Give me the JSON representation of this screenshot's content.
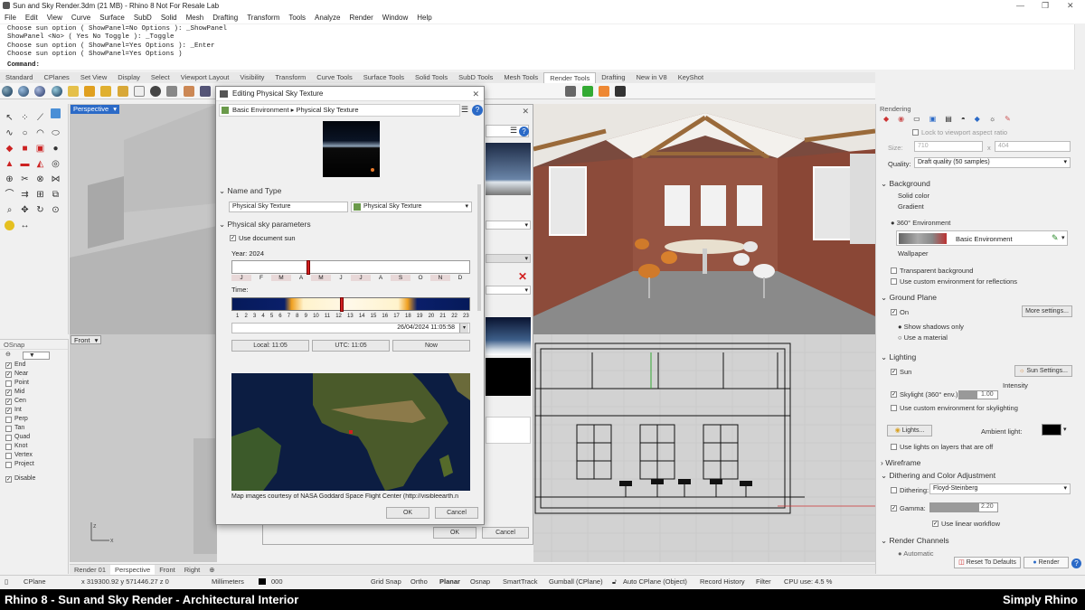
{
  "window": {
    "title": "Sun and Sky Render.3dm (21 MB) - Rhino 8 Not For Resale Lab"
  },
  "menu": [
    "File",
    "Edit",
    "View",
    "Curve",
    "Surface",
    "SubD",
    "Solid",
    "Mesh",
    "Drafting",
    "Transform",
    "Tools",
    "Analyze",
    "Render",
    "Window",
    "Help"
  ],
  "command": {
    "history": [
      "Choose sun option ( ShowPanel=No  Options ): _ShowPanel",
      "ShowPanel <No> ( Yes  No  Toggle ): _Toggle",
      "Choose sun option ( ShowPanel=Yes  Options ): _Enter",
      "Choose sun option ( ShowPanel=Yes  Options )"
    ],
    "prompt": "Command:"
  },
  "toolbar_tabs": [
    "Standard",
    "CPlanes",
    "Set View",
    "Display",
    "Select",
    "Viewport Layout",
    "Visibility",
    "Transform",
    "Curve Tools",
    "Surface Tools",
    "Solid Tools",
    "SubD Tools",
    "Mesh Tools",
    "Render Tools",
    "Drafting",
    "New in V8",
    "KeyShot"
  ],
  "toolbar_tabs_selected": "Render Tools",
  "viewports": {
    "perspective": "Perspective",
    "front": "Front"
  },
  "osnap": {
    "title": "OSnap",
    "items": [
      {
        "label": "End",
        "checked": true
      },
      {
        "label": "Near",
        "checked": true
      },
      {
        "label": "Point",
        "checked": false
      },
      {
        "label": "Mid",
        "checked": true
      },
      {
        "label": "Cen",
        "checked": true
      },
      {
        "label": "Int",
        "checked": true
      },
      {
        "label": "Perp",
        "checked": false
      },
      {
        "label": "Tan",
        "checked": false
      },
      {
        "label": "Quad",
        "checked": false
      },
      {
        "label": "Knot",
        "checked": false
      },
      {
        "label": "Vertex",
        "checked": false
      },
      {
        "label": "Project",
        "checked": false
      }
    ],
    "disable": "Disable"
  },
  "dialog": {
    "title": "Editing Physical Sky Texture",
    "breadcrumb_root": "Basic Environment",
    "breadcrumb_sep": "▸",
    "breadcrumb_leaf": "Physical Sky Texture",
    "name_type_section": "Name and Type",
    "name_value": "Physical Sky Texture",
    "type_value": "Physical Sky Texture",
    "params_section": "Physical sky parameters",
    "use_doc_sun": "Use document sun",
    "year_label": "Year: 2024",
    "months": [
      "J",
      "F",
      "M",
      "A",
      "M",
      "J",
      "J",
      "A",
      "S",
      "O",
      "N",
      "D"
    ],
    "time_label": "Time:",
    "hours": [
      "1",
      "2",
      "3",
      "4",
      "5",
      "6",
      "7",
      "8",
      "9",
      "10",
      "11",
      "12",
      "13",
      "14",
      "15",
      "16",
      "17",
      "18",
      "19",
      "20",
      "21",
      "22",
      "23"
    ],
    "datetime": "26/04/2024 11:05:58",
    "local": "Local: 11:05",
    "utc": "UTC: 11:05",
    "now": "Now",
    "map_credit": "Map images courtesy of NASA Goddard Space Flight Center (http://visibleearth.n",
    "ok": "OK",
    "cancel": "Cancel"
  },
  "bg_dialog": {
    "ok": "OK",
    "cancel": "Cancel"
  },
  "rendering": {
    "title": "Rendering",
    "lock_aspect": "Lock to viewport aspect ratio",
    "size_label": "Size:",
    "width": "710",
    "x": "x",
    "height": "404",
    "quality_label": "Quality:",
    "quality_value": "Draft quality (50 samples)",
    "background": "Background",
    "solid_color": "Solid color",
    "gradient": "Gradient",
    "env360": "360° Environment",
    "env_name": "Basic Environment",
    "wallpaper": "Wallpaper",
    "transparent_bg": "Transparent background",
    "custom_env_reflections": "Use custom environment for reflections",
    "ground_plane": "Ground Plane",
    "on": "On",
    "more_settings": "More settings...",
    "show_shadows_only": "Show shadows only",
    "use_material": "Use a material",
    "lighting": "Lighting",
    "sun": "Sun",
    "sun_settings": "Sun Settings...",
    "intensity": "Intensity",
    "skylight": "Skylight (360° env.)",
    "skylight_value": "1.00",
    "custom_env_skylighting": "Use custom environment for skylighting",
    "lights_btn": "Lights...",
    "ambient_light": "Ambient light:",
    "lights_on_layers_off": "Use lights on layers that are off",
    "wireframe": "Wireframe",
    "dithering_section": "Dithering and Color Adjustment",
    "dithering_label": "Dithering:",
    "dithering_value": "Floyd-Steinberg",
    "gamma_label": "Gamma:",
    "gamma_value": "2.20",
    "linear_workflow": "Use linear workflow",
    "render_channels": "Render Channels",
    "automatic": "Automatic",
    "reset_defaults": "Reset To Defaults",
    "render": "Render"
  },
  "bottom_tabs": [
    "Render 01",
    "Perspective",
    "Front",
    "Right"
  ],
  "bottom_tabs_selected": "Perspective",
  "status": {
    "cplane": "CPlane",
    "coords": "x 319300.92  y 571446.27  z 0",
    "units": "Millimeters",
    "layer": "000",
    "grid_snap": "Grid Snap",
    "ortho": "Ortho",
    "planar": "Planar",
    "osnap": "Osnap",
    "smarttrack": "SmartTrack",
    "gumball": "Gumball (CPlane)",
    "auto_cplane": "Auto CPlane (Object)",
    "record_history": "Record History",
    "filter": "Filter",
    "cpu": "CPU use: 4.5 %"
  },
  "caption": {
    "left": "Rhino 8 - Sun and Sky Render - Architectural Interior",
    "right": "Simply Rhino"
  },
  "colors": {
    "accent": "#2b6ac7",
    "selected_marker": "#d21f1f",
    "brick": "#8a4a3a"
  }
}
